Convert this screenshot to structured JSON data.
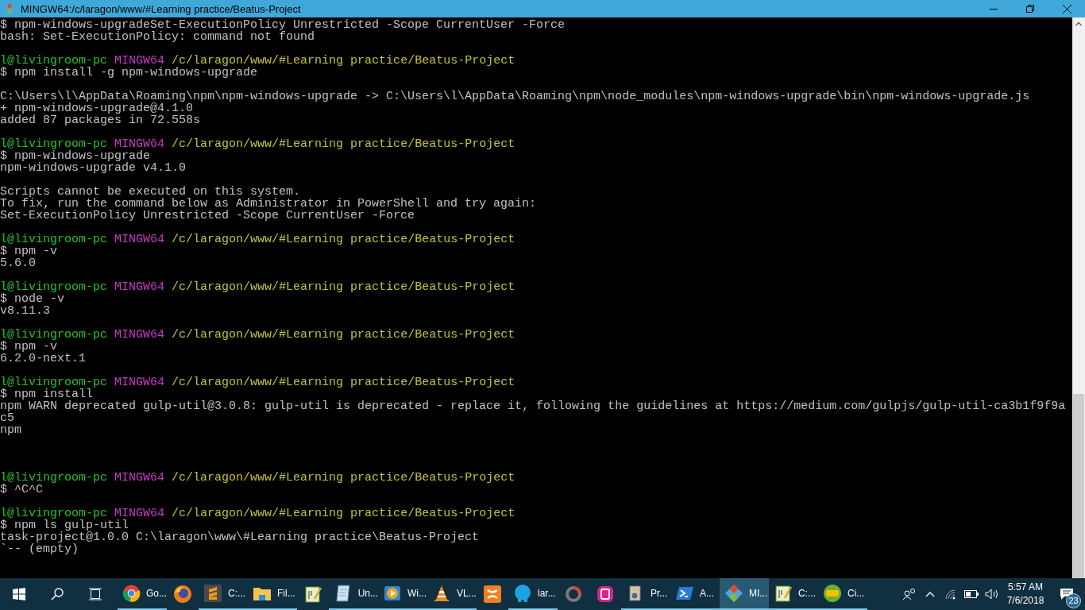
{
  "window": {
    "title": "MINGW64:/c/laragon/www/#Learning practice/Beatus-Project"
  },
  "terminal": {
    "lines": [
      {
        "kind": "text",
        "text": "$ npm-windows-upgradeSet-ExecutionPolicy Unrestricted -Scope CurrentUser -Force"
      },
      {
        "kind": "text",
        "text": "bash: Set-ExecutionPolicy: command not found"
      },
      {
        "kind": "blank"
      },
      {
        "kind": "prompt",
        "user": "l@livingroom-pc",
        "shell": "MINGW64",
        "path": "/c/laragon/www/#Learning practice/Beatus-Project"
      },
      {
        "kind": "text",
        "text": "$ npm install -g npm-windows-upgrade"
      },
      {
        "kind": "blank"
      },
      {
        "kind": "text",
        "text": "C:\\Users\\l\\AppData\\Roaming\\npm\\npm-windows-upgrade -> C:\\Users\\l\\AppData\\Roaming\\npm\\node_modules\\npm-windows-upgrade\\bin\\npm-windows-upgrade.js"
      },
      {
        "kind": "text",
        "text": "+ npm-windows-upgrade@4.1.0"
      },
      {
        "kind": "text",
        "text": "added 87 packages in 72.558s"
      },
      {
        "kind": "blank"
      },
      {
        "kind": "prompt",
        "user": "l@livingroom-pc",
        "shell": "MINGW64",
        "path": "/c/laragon/www/#Learning practice/Beatus-Project"
      },
      {
        "kind": "text",
        "text": "$ npm-windows-upgrade"
      },
      {
        "kind": "text",
        "text": "npm-windows-upgrade v4.1.0"
      },
      {
        "kind": "blank"
      },
      {
        "kind": "text",
        "text": "Scripts cannot be executed on this system."
      },
      {
        "kind": "text",
        "text": "To fix, run the command below as Administrator in PowerShell and try again:"
      },
      {
        "kind": "text",
        "text": "Set-ExecutionPolicy Unrestricted -Scope CurrentUser -Force"
      },
      {
        "kind": "blank"
      },
      {
        "kind": "prompt",
        "user": "l@livingroom-pc",
        "shell": "MINGW64",
        "path": "/c/laragon/www/#Learning practice/Beatus-Project"
      },
      {
        "kind": "text",
        "text": "$ npm -v"
      },
      {
        "kind": "text",
        "text": "5.6.0"
      },
      {
        "kind": "blank"
      },
      {
        "kind": "prompt",
        "user": "l@livingroom-pc",
        "shell": "MINGW64",
        "path": "/c/laragon/www/#Learning practice/Beatus-Project"
      },
      {
        "kind": "text",
        "text": "$ node -v"
      },
      {
        "kind": "text",
        "text": "v8.11.3"
      },
      {
        "kind": "blank"
      },
      {
        "kind": "prompt",
        "user": "l@livingroom-pc",
        "shell": "MINGW64",
        "path": "/c/laragon/www/#Learning practice/Beatus-Project"
      },
      {
        "kind": "text",
        "text": "$ npm -v"
      },
      {
        "kind": "text",
        "text": "6.2.0-next.1"
      },
      {
        "kind": "blank"
      },
      {
        "kind": "prompt",
        "user": "l@livingroom-pc",
        "shell": "MINGW64",
        "path": "/c/laragon/www/#Learning practice/Beatus-Project"
      },
      {
        "kind": "text",
        "text": "$ npm install"
      },
      {
        "kind": "text",
        "text": "npm WARN deprecated gulp-util@3.0.8: gulp-util is deprecated - replace it, following the guidelines at https://medium.com/gulpjs/gulp-util-ca3b1f9f9a"
      },
      {
        "kind": "text",
        "text": "c5"
      },
      {
        "kind": "text",
        "text": "npm"
      },
      {
        "kind": "blank"
      },
      {
        "kind": "blank"
      },
      {
        "kind": "blank"
      },
      {
        "kind": "prompt",
        "user": "l@livingroom-pc",
        "shell": "MINGW64",
        "path": "/c/laragon/www/#Learning practice/Beatus-Project"
      },
      {
        "kind": "text",
        "text": "$ ^C^C"
      },
      {
        "kind": "blank"
      },
      {
        "kind": "prompt",
        "user": "l@livingroom-pc",
        "shell": "MINGW64",
        "path": "/c/laragon/www/#Learning practice/Beatus-Project"
      },
      {
        "kind": "text",
        "text": "$ npm ls gulp-util"
      },
      {
        "kind": "text",
        "text": "task-project@1.0.0 C:\\laragon\\www\\#Learning practice\\Beatus-Project"
      },
      {
        "kind": "text",
        "text": "`-- (empty)"
      }
    ]
  },
  "taskbar": {
    "apps": [
      {
        "label": "Go...",
        "running": true,
        "selected": false
      },
      {
        "running": false,
        "selected": false
      },
      {
        "label": "C:...",
        "running": true,
        "selected": false
      },
      {
        "label": "Fil...",
        "running": true,
        "selected": false
      },
      {
        "running": false,
        "selected": false
      },
      {
        "label": "Un...",
        "running": true,
        "selected": false
      },
      {
        "label": "Wi...",
        "running": true,
        "selected": false
      },
      {
        "label": "VL...",
        "running": true,
        "selected": false
      },
      {
        "running": false,
        "selected": false
      },
      {
        "label": "lar...",
        "running": true,
        "selected": false
      },
      {
        "running": false,
        "selected": false
      },
      {
        "running": false,
        "selected": false
      },
      {
        "label": "Pr...",
        "running": true,
        "selected": false
      },
      {
        "label": "A...",
        "running": true,
        "selected": false
      },
      {
        "label": "MI...",
        "running": true,
        "selected": true
      },
      {
        "label": "C:...",
        "running": true,
        "selected": false
      },
      {
        "label": "Ci...",
        "running": true,
        "selected": false
      }
    ],
    "clock": {
      "time": "5:57 AM",
      "date": "7/6/2018"
    },
    "notifications": {
      "count": "23"
    }
  }
}
